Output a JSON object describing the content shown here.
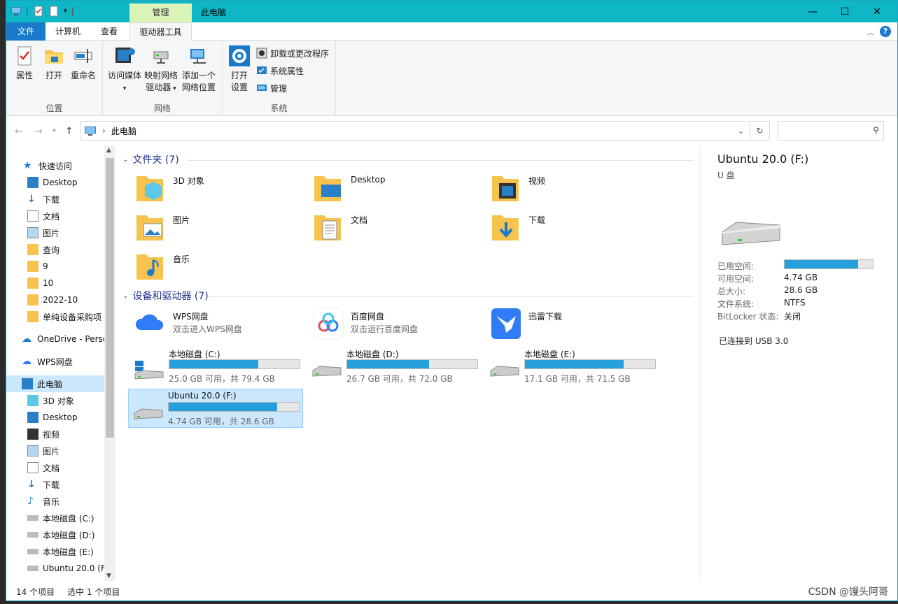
{
  "window": {
    "context_tab": "管理",
    "title": "此电脑"
  },
  "ribbon_tabs": [
    "文件",
    "计算机",
    "查看",
    "驱动器工具"
  ],
  "ribbon": {
    "location_group": "位置",
    "network_group": "网络",
    "system_group": "系统",
    "properties": "属性",
    "open": "打开",
    "rename": "重命名",
    "access_media": "访问媒体",
    "map_drive_1": "映射网络",
    "map_drive_2": "驱动器",
    "add_location_1": "添加一个",
    "add_location_2": "网络位置",
    "open_settings_1": "打开",
    "open_settings_2": "设置",
    "uninstall": "卸载或更改程序",
    "sys_props": "系统属性",
    "manage": "管理"
  },
  "address": {
    "path": "此电脑",
    "search_placeholder": ""
  },
  "nav": {
    "quick_access": "快速访问",
    "items": [
      "Desktop",
      "下载",
      "文档",
      "图片",
      "查询",
      "9",
      "10",
      "2022-10",
      "单纯设备采购项"
    ],
    "onedrive": "OneDrive - Perso",
    "wps": "WPS网盘",
    "this_pc": "此电脑",
    "pc_items": [
      "3D 对象",
      "Desktop",
      "视频",
      "图片",
      "文档",
      "下载",
      "音乐",
      "本地磁盘 (C:)",
      "本地磁盘 (D:)",
      "本地磁盘 (E:)",
      "Ubuntu 20.0 (F:"
    ]
  },
  "folders": {
    "header": "文件夹 (7)",
    "items": [
      "3D 对象",
      "Desktop",
      "视频",
      "图片",
      "文档",
      "下载",
      "音乐"
    ]
  },
  "devices": {
    "header": "设备和驱动器 (7)",
    "apps": [
      {
        "name": "WPS网盘",
        "sub": "双击进入WPS网盘"
      },
      {
        "name": "百度网盘",
        "sub": "双击运行百度网盘"
      },
      {
        "name": "迅雷下载",
        "sub": ""
      }
    ],
    "drives": [
      {
        "name": "本地磁盘 (C:)",
        "text": "25.0 GB 可用，共 79.4 GB",
        "used": 0.685
      },
      {
        "name": "本地磁盘 (D:)",
        "text": "26.7 GB 可用，共 72.0 GB",
        "used": 0.63
      },
      {
        "name": "本地磁盘 (E:)",
        "text": "17.1 GB 可用，共 71.5 GB",
        "used": 0.76
      },
      {
        "name": "Ubuntu 20.0 (F:)",
        "text": "4.74 GB 可用，共 28.6 GB",
        "used": 0.834
      }
    ]
  },
  "details": {
    "title": "Ubuntu 20.0 (F:)",
    "subtitle": "U 盘",
    "used_label": "已用空间:",
    "used_fraction": 0.834,
    "free_label": "可用空间:",
    "free_value": "4.74 GB",
    "total_label": "总大小:",
    "total_value": "28.6 GB",
    "fs_label": "文件系统:",
    "fs_value": "NTFS",
    "bitlocker_label": "BitLocker 状态:",
    "bitlocker_value": "关闭",
    "connected": "已连接到 USB 3.0"
  },
  "status": {
    "count": "14 个项目",
    "selected": "选中 1 个项目"
  },
  "watermark": "CSDN @馒头阿哥",
  "colors": {
    "title_bar": "#0fb6c6",
    "accent": "#1979ca",
    "bar_fill": "#26a0da",
    "selection": "#cce8ff"
  }
}
